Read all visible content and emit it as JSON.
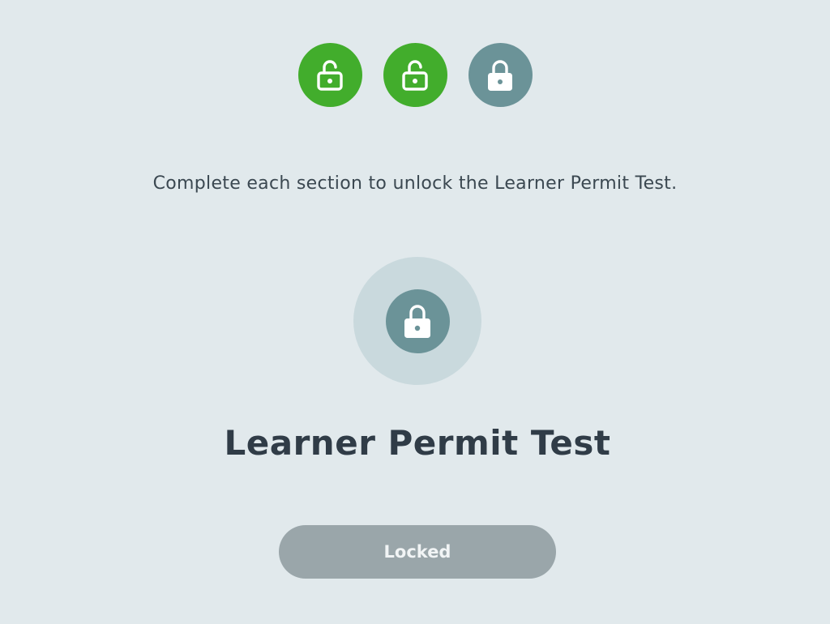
{
  "progress": {
    "steps": [
      {
        "state": "unlocked",
        "icon": "unlocked-padlock-icon"
      },
      {
        "state": "unlocked",
        "icon": "unlocked-padlock-icon"
      },
      {
        "state": "locked",
        "icon": "padlock-icon"
      }
    ]
  },
  "instruction": "Complete each section to unlock the Learner Permit Test.",
  "test": {
    "icon": "padlock-icon",
    "title": "Learner Permit Test",
    "button_label": "Locked"
  },
  "colors": {
    "background": "#e1e9ec",
    "unlocked": "#42ad2c",
    "locked": "#6b9398",
    "button_disabled": "#9aa6aa",
    "title_text": "#303c47"
  }
}
